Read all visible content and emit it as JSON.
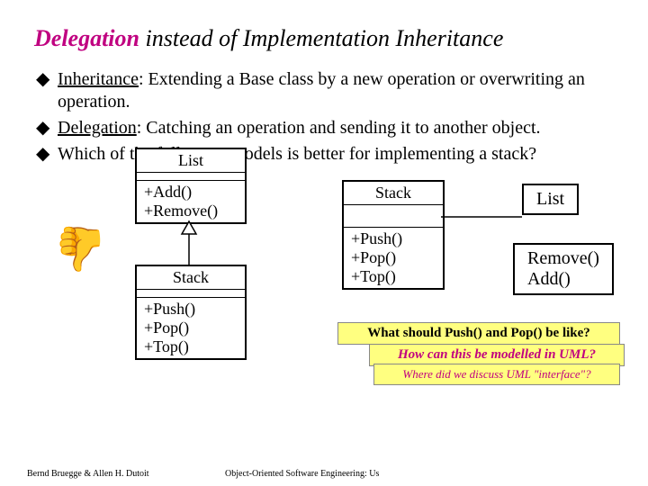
{
  "title": {
    "emph": "Delegation",
    "rest": " instead of Implementation Inheritance"
  },
  "bullets": [
    {
      "term": "Inheritance",
      "rest": ": Extending a Base class by a new operation or overwriting an operation."
    },
    {
      "term": "Delegation",
      "rest": ": Catching an operation and sending it to another object."
    },
    {
      "term": "",
      "rest": "Which of the following models is better for implementing a stack?"
    }
  ],
  "uml": {
    "list_inh": {
      "name": "List",
      "ops": "+Add()\n+Remove()"
    },
    "stack_inh": {
      "name": "Stack",
      "ops": "+Push()\n+Pop()\n+Top()"
    },
    "stack_del": {
      "name": "Stack",
      "ops": "+Push()\n+Pop()\n+Top()"
    },
    "list_del": {
      "name": "List",
      "ops": "Remove()\nAdd()"
    }
  },
  "callouts": {
    "q1": "What should Push() and Pop() be like?",
    "q2": "How can this be modelled in UML?",
    "q3": "Where did we discuss UML \"interface\"?"
  },
  "footer": {
    "left": "Bernd Bruegge & Allen H. Dutoit",
    "center": "Object-Oriented Software Engineering: Us"
  }
}
